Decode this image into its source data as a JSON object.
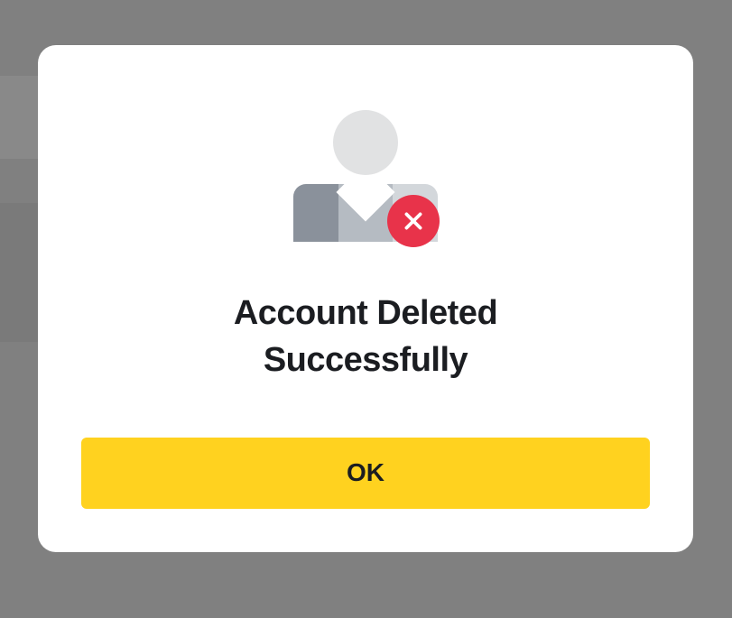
{
  "modal": {
    "title": "Account Deleted Successfully",
    "ok_label": "OK",
    "icon": "user-deleted-icon",
    "badge_icon": "close-icon",
    "accent_color": "#ffd21f",
    "badge_color": "#e8334a"
  }
}
